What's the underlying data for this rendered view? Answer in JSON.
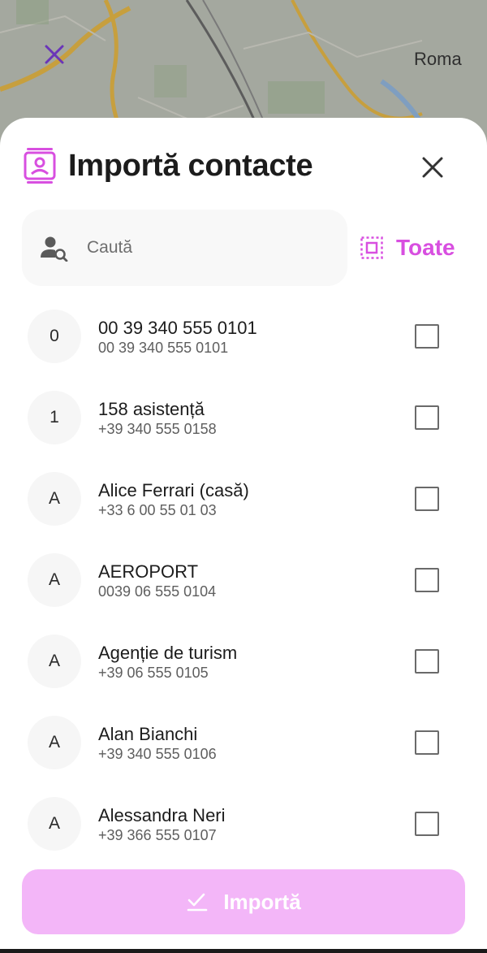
{
  "map": {
    "city_label": "Roma"
  },
  "header": {
    "title": "Importă contacte"
  },
  "search": {
    "placeholder": "Caută",
    "value": ""
  },
  "select_all": {
    "label": "Toate"
  },
  "contacts": [
    {
      "initial": "0",
      "name": "00 39 340 555 0101",
      "phone": "00 39 340 555 0101",
      "checked": false
    },
    {
      "initial": "1",
      "name": "158 asistență",
      "phone": "+39 340 555 0158",
      "checked": false
    },
    {
      "initial": "A",
      "name": "Alice Ferrari (casă)",
      "phone": "+33 6 00 55 01 03",
      "checked": false
    },
    {
      "initial": "A",
      "name": "AEROPORT",
      "phone": "0039 06 555 0104",
      "checked": false
    },
    {
      "initial": "A",
      "name": "Agenție de turism",
      "phone": "+39 06 555 0105",
      "checked": false
    },
    {
      "initial": "A",
      "name": "Alan Bianchi",
      "phone": "+39 340 555 0106",
      "checked": false
    },
    {
      "initial": "A",
      "name": "Alessandra Neri",
      "phone": "+39 366 555 0107",
      "checked": false
    }
  ],
  "import_button": {
    "label": "Importă",
    "enabled": false
  },
  "colors": {
    "accent": "#d84fe0",
    "button_disabled": "#f3b6f8",
    "map_marker": "#6a35b8"
  },
  "icons": {
    "header": "contacts-icon",
    "close": "close-icon",
    "search": "person-search-icon",
    "select_all": "select-all-icon",
    "import": "check-icon",
    "map": "map-marker-icon"
  }
}
